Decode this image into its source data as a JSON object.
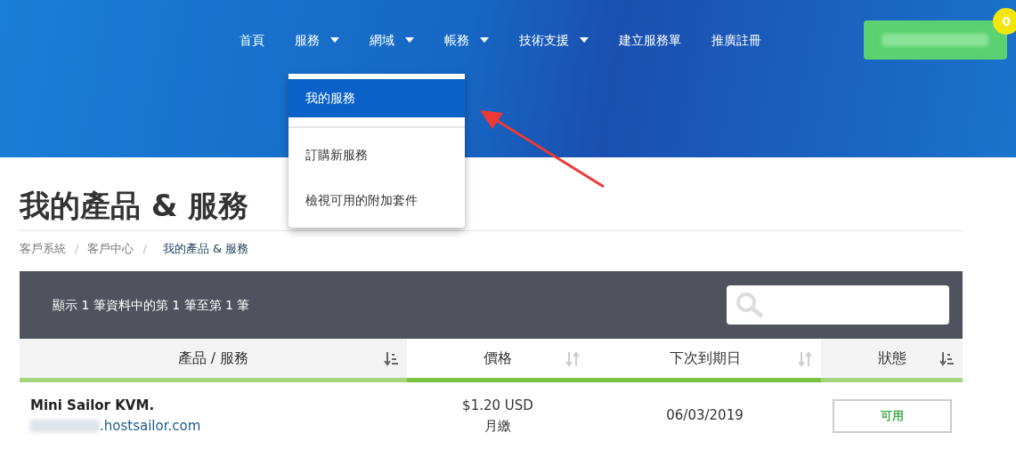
{
  "nav": {
    "items": [
      {
        "label": "首頁",
        "dropdown": false
      },
      {
        "label": "服務",
        "dropdown": true
      },
      {
        "label": "網域",
        "dropdown": true
      },
      {
        "label": "帳務",
        "dropdown": true
      },
      {
        "label": "技術支援",
        "dropdown": true
      },
      {
        "label": "建立服務單",
        "dropdown": false
      },
      {
        "label": "推廣註冊",
        "dropdown": false
      }
    ],
    "cart_badge": "0"
  },
  "dropdown_menu": [
    {
      "kind": "item",
      "label": "我的服務",
      "selected": true
    },
    {
      "kind": "divider"
    },
    {
      "kind": "item",
      "label": "訂購新服務",
      "selected": false
    },
    {
      "kind": "item",
      "label": "檢視可用的附加套件",
      "selected": false
    }
  ],
  "page_title": "我的產品 & 服務",
  "breadcrumb": [
    {
      "label": "客戶系統",
      "current": false
    },
    {
      "separator": "/",
      "label": "客戶中心",
      "current": false
    },
    {
      "separator": "/",
      "label": "我的產品 & 服務",
      "current": true
    }
  ],
  "table": {
    "info": "顯示 1 筆資料中的第 1 筆至第 1 筆",
    "columns": [
      {
        "label": "產品 / 服務",
        "sorted": true
      },
      {
        "label": "價格",
        "sorted": false
      },
      {
        "label": "下次到期日",
        "sorted": false
      },
      {
        "label": "狀態",
        "sorted": true
      }
    ],
    "rows": [
      {
        "product": "Mini Sailor KVM.",
        "domain": ".hostsailor.com",
        "price": "$1.20 USD",
        "cycle": "月繳",
        "due_date": "06/03/2019",
        "status": "可用"
      }
    ]
  }
}
